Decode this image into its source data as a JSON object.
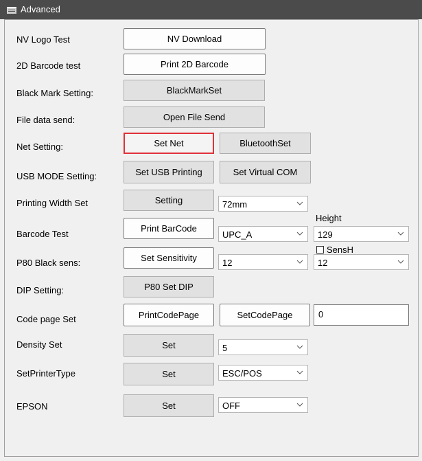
{
  "window": {
    "title": "Advanced",
    "icon": "window-icon"
  },
  "labels": {
    "nv_logo": "NV Logo Test",
    "barcode_2d": "2D Barcode test",
    "black_mark": "Black Mark Setting:",
    "file_data": "File data send:",
    "net_setting": "Net Setting:",
    "usb_mode": "USB MODE Setting:",
    "printing_width": "Printing Width Set",
    "barcode_test": "Barcode Test",
    "p80_black": "P80 Black sens:",
    "dip_setting": "DIP Setting:",
    "code_page": "Code page Set",
    "density": "Density Set",
    "printer_type": "SetPrinterType",
    "epson": "EPSON",
    "height": "Height",
    "sensh": "SensH"
  },
  "buttons": {
    "nv_download": "NV Download",
    "print_2d": "Print 2D Barcode",
    "black_mark_set": "BlackMarkSet",
    "open_file_send": "Open File Send",
    "set_net": "Set Net",
    "bluetooth_set": "BluetoothSet",
    "set_usb_printing": "Set USB Printing",
    "set_virtual_com": "Set Virtual COM",
    "width_setting": "Setting",
    "print_barcode": "Print BarCode",
    "set_sensitivity": "Set Sensitivity",
    "p80_set_dip": "P80 Set DIP",
    "print_code_page": "PrintCodePage",
    "set_code_page": "SetCodePage",
    "density_set": "Set",
    "printer_type_set": "Set",
    "epson_set": "Set"
  },
  "combos": {
    "printing_width": "72mm",
    "barcode_type": "UPC_A",
    "height": "129",
    "black_sens": "12",
    "sensh": "12",
    "density": "5",
    "printer_type": "ESC/POS",
    "epson": "OFF"
  },
  "inputs": {
    "code_page": "0"
  },
  "checkbox": {
    "sensh_checked": false
  },
  "colors": {
    "titlebar": "#4b4b4b",
    "selected_border": "#e0303a",
    "background": "#f0f0f0"
  }
}
